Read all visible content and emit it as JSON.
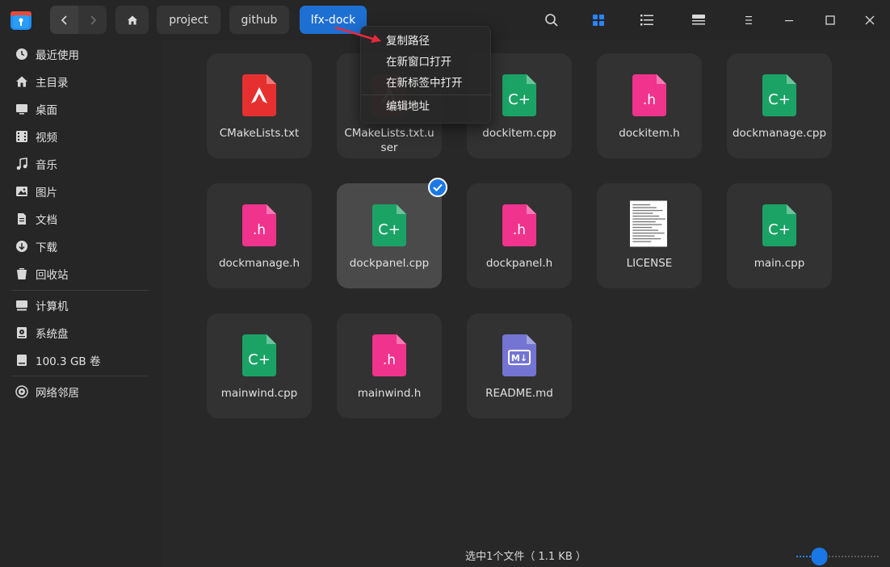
{
  "breadcrumbs": [
    "project",
    "github",
    "lfx-dock"
  ],
  "sidebar": {
    "items": [
      {
        "label": "最近使用",
        "icon": "clock-icon"
      },
      {
        "label": "主目录",
        "icon": "home-icon"
      },
      {
        "label": "桌面",
        "icon": "desktop-icon"
      },
      {
        "label": "视频",
        "icon": "video-icon"
      },
      {
        "label": "音乐",
        "icon": "music-icon"
      },
      {
        "label": "图片",
        "icon": "picture-icon"
      },
      {
        "label": "文档",
        "icon": "document-icon"
      },
      {
        "label": "下载",
        "icon": "download-icon"
      },
      {
        "label": "回收站",
        "icon": "trash-icon"
      },
      {
        "label": "计算机",
        "icon": "computer-icon"
      },
      {
        "label": "系统盘",
        "icon": "disk-icon"
      },
      {
        "label": "100.3 GB 卷",
        "icon": "drive-icon"
      },
      {
        "label": "网络邻居",
        "icon": "network-icon"
      }
    ]
  },
  "files": [
    {
      "name": "CMakeLists.txt",
      "type": "cmake",
      "badge": ""
    },
    {
      "name": "CMakeLists.txt.user",
      "type": "cmake",
      "badge": ""
    },
    {
      "name": "dockitem.cpp",
      "type": "cpp",
      "badge": "C+"
    },
    {
      "name": "dockitem.h",
      "type": "header",
      "badge": ".h"
    },
    {
      "name": "dockmanage.cpp",
      "type": "cpp",
      "badge": "C+"
    },
    {
      "name": "dockmanage.h",
      "type": "header",
      "badge": ".h"
    },
    {
      "name": "dockpanel.cpp",
      "type": "cpp",
      "badge": "C+",
      "selected": true
    },
    {
      "name": "dockpanel.h",
      "type": "header",
      "badge": ".h"
    },
    {
      "name": "LICENSE",
      "type": "text",
      "badge": ""
    },
    {
      "name": "main.cpp",
      "type": "cpp",
      "badge": "C+"
    },
    {
      "name": "mainwind.cpp",
      "type": "cpp",
      "badge": "C+"
    },
    {
      "name": "mainwind.h",
      "type": "header",
      "badge": ".h"
    },
    {
      "name": "README.md",
      "type": "markdown",
      "badge": "M↓"
    }
  ],
  "context_menu": {
    "items": [
      "复制路径",
      "在新窗口打开",
      "在新标签中打开",
      "编辑地址"
    ]
  },
  "status": {
    "text": "选中1个文件（ 1.1 KB ）"
  },
  "zoom": {
    "level": 0.28
  },
  "colors": {
    "accent": "#1e6fd2",
    "cpp": "#1ba366",
    "header": "#f0338c",
    "cmake": "#e63030",
    "markdown": "#7474d4"
  }
}
